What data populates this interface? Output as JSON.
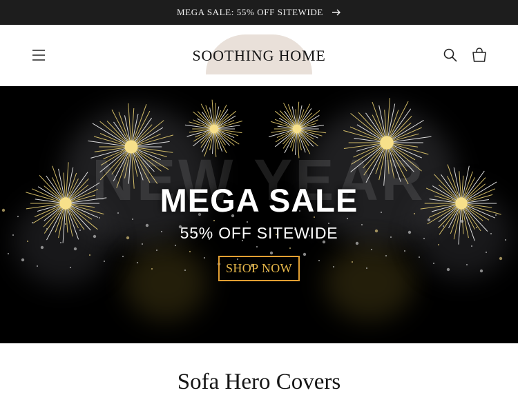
{
  "announcement": {
    "text": "MEGA SALE: 55% OFF SITEWIDE",
    "arrow_icon": "arrow-right-icon"
  },
  "header": {
    "logo": "SOOTHING HOME",
    "menu_icon": "hamburger-menu-icon",
    "search_icon": "search-icon",
    "cart_icon": "cart-icon"
  },
  "hero": {
    "background_text": "NEW YEAR",
    "title": "MEGA SALE",
    "subtitle": "55% OFF SITEWIDE",
    "cta": "SHOP NOW"
  },
  "section": {
    "title": "Sofa Hero Covers"
  },
  "colors": {
    "announcement_bg": "#1d1d1d",
    "logo_arch": "#e9e0d9",
    "hero_bg": "#000000",
    "gold": "#e3a033",
    "firework": "#f1d774"
  }
}
